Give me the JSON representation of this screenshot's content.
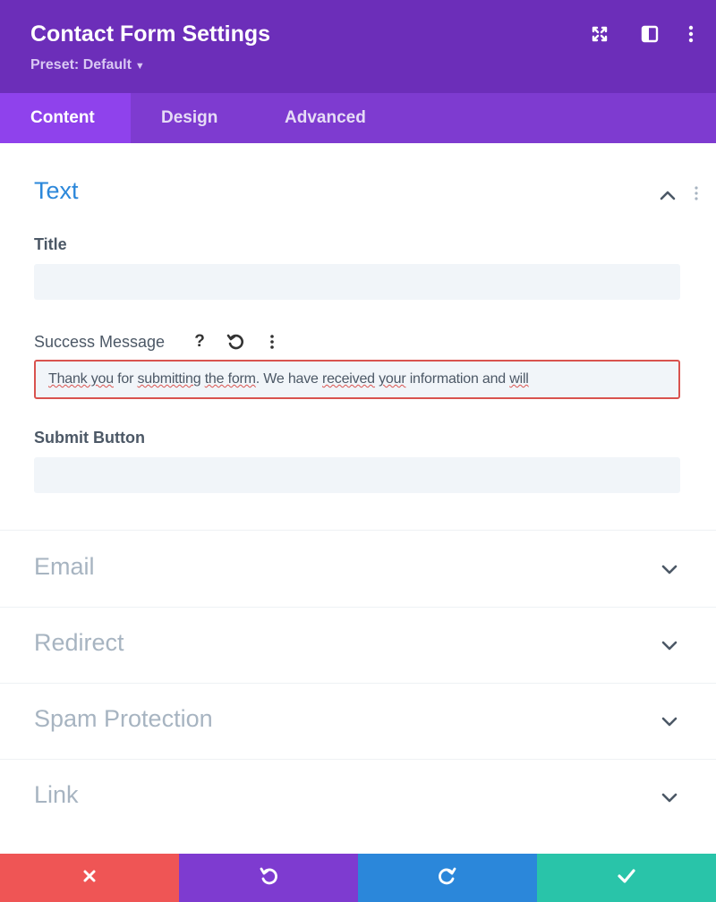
{
  "header": {
    "title": "Contact Form Settings",
    "preset_label": "Preset: Default",
    "icons": [
      "expand-icon",
      "sidebar-toggle-icon",
      "kebab-menu-icon"
    ],
    "colors": {
      "header_bg": "#6c2eb9",
      "tabs_bg": "#7e3bd0",
      "active_tab_bg": "#8f42ec"
    }
  },
  "tabs": [
    {
      "label": "Content",
      "active": true
    },
    {
      "label": "Design",
      "active": false
    },
    {
      "label": "Advanced",
      "active": false
    }
  ],
  "text_section": {
    "title": "Text",
    "title_color": "#2b87da",
    "fields": {
      "title": {
        "label": "Title",
        "value": ""
      },
      "success_message": {
        "label": "Success Message",
        "value": "Thank you for submitting the form. We have received your information and will",
        "value_parts": [
          {
            "text": "Thank you",
            "misspelled": true
          },
          {
            "text": " for ",
            "misspelled": false
          },
          {
            "text": "submitting",
            "misspelled": true
          },
          {
            "text": " ",
            "misspelled": false
          },
          {
            "text": "the form",
            "misspelled": true
          },
          {
            "text": ". We have ",
            "misspelled": false
          },
          {
            "text": "received",
            "misspelled": true
          },
          {
            "text": " ",
            "misspelled": false
          },
          {
            "text": "your",
            "misspelled": true
          },
          {
            "text": " information and ",
            "misspelled": false
          },
          {
            "text": "will",
            "misspelled": true
          }
        ],
        "icons": [
          "help-icon",
          "reset-icon",
          "kebab-menu-icon"
        ],
        "highlight_color": "#d9534f"
      },
      "submit_button": {
        "label": "Submit Button",
        "value": ""
      }
    }
  },
  "collapsed_sections": [
    {
      "title": "Email"
    },
    {
      "title": "Redirect"
    },
    {
      "title": "Spam Protection"
    },
    {
      "title": "Link"
    }
  ],
  "footer": {
    "buttons": [
      {
        "name": "cancel",
        "icon": "close-icon",
        "color": "#ef5555"
      },
      {
        "name": "undo",
        "icon": "undo-icon",
        "color": "#7e3bd0"
      },
      {
        "name": "redo",
        "icon": "redo-icon",
        "color": "#2b87da"
      },
      {
        "name": "save",
        "icon": "check-icon",
        "color": "#29c4a9"
      }
    ]
  }
}
